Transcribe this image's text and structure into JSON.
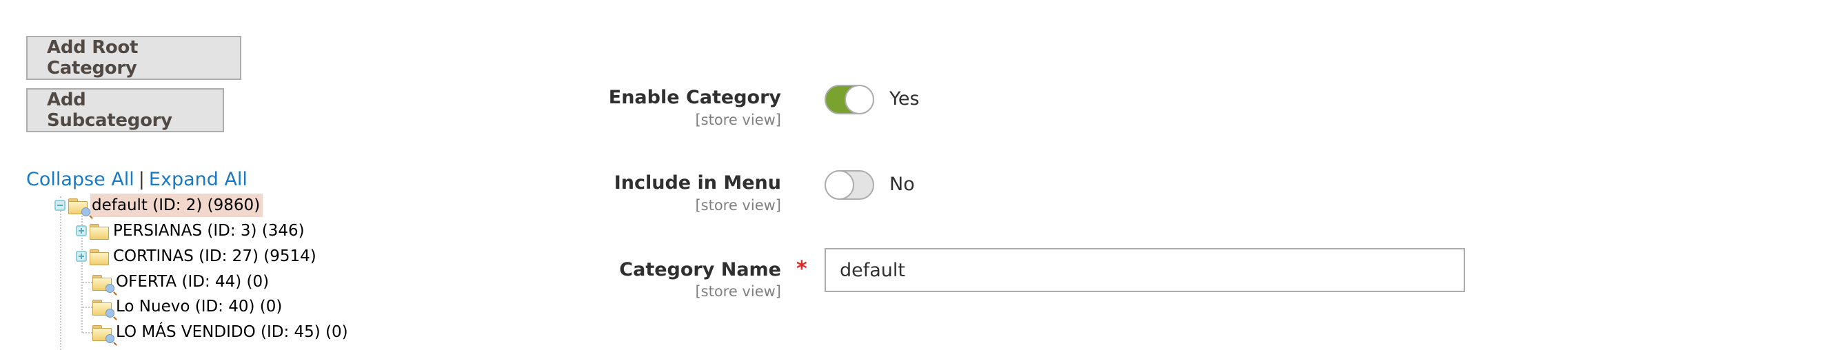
{
  "actions": {
    "add_root_category": "Add Root Category",
    "add_subcategory": "Add Subcategory"
  },
  "tree_controls": {
    "collapse_all": "Collapse All",
    "separator": "|",
    "expand_all": "Expand All"
  },
  "tree": {
    "root": {
      "label": "default (ID: 2) (9860)",
      "expanded": true,
      "selected": true,
      "icon": "folder-search-icon"
    },
    "children": [
      {
        "label": "PERSIANAS (ID: 3) (346)",
        "expandable": true,
        "icon": "folder-icon"
      },
      {
        "label": "CORTINAS (ID: 27) (9514)",
        "expandable": true,
        "icon": "folder-icon"
      },
      {
        "label": "OFERTA (ID: 44) (0)",
        "expandable": false,
        "icon": "folder-search-icon"
      },
      {
        "label": "Lo Nuevo (ID: 40) (0)",
        "expandable": false,
        "icon": "folder-search-icon"
      },
      {
        "label": "LO MÁS VENDIDO (ID: 45) (0)",
        "expandable": false,
        "icon": "folder-search-icon"
      }
    ]
  },
  "form": {
    "enable_category": {
      "label": "Enable Category",
      "scope": "[store view]",
      "value": true,
      "value_text": "Yes"
    },
    "include_in_menu": {
      "label": "Include in Menu",
      "scope": "[store view]",
      "value": false,
      "value_text": "No"
    },
    "category_name": {
      "label": "Category Name",
      "scope": "[store view]",
      "required_mark": "*",
      "value": "default"
    }
  },
  "colors": {
    "link": "#1979c3",
    "toggle_on": "#79a22e",
    "required": "#e22626",
    "selected_node": "#f2d8cc"
  }
}
